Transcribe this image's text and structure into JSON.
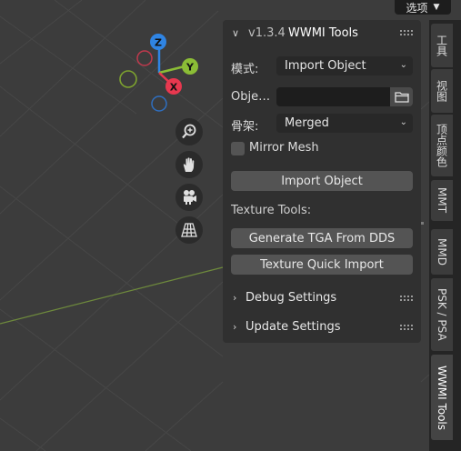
{
  "header": {
    "view_dropdown": "选项"
  },
  "gizmo": {
    "z_label": "Z",
    "y_label": "Y",
    "x_label": "X",
    "colors": {
      "x": "#e8384f",
      "y": "#8bbd36",
      "z": "#2f84e3"
    }
  },
  "navigation": {
    "buttons": [
      "zoom-icon",
      "hand-pan-icon",
      "camera-icon",
      "grid-perspective-icon"
    ]
  },
  "panel": {
    "version": "v1.3.4",
    "title": "WWMI Tools",
    "mode_label": "模式:",
    "mode_value": "Import Object",
    "object_label": "Obje…",
    "object_value": "",
    "skeleton_label": "骨架:",
    "skeleton_value": "Merged",
    "mirror_mesh_label": "Mirror Mesh",
    "mirror_mesh_checked": false,
    "import_button": "Import Object",
    "texture_tools_label": "Texture Tools:",
    "generate_tga_button": "Generate TGA From DDS",
    "texture_import_button": "Texture Quick Import",
    "debug_settings": "Debug Settings",
    "update_settings": "Update Settings"
  },
  "sidebar_tabs": [
    {
      "label": "工具",
      "active": false
    },
    {
      "label": "视图",
      "active": false
    },
    {
      "label": "顶点颜色",
      "active": false
    },
    {
      "label": "MMT",
      "active": false
    },
    {
      "label": "MMD",
      "active": false
    },
    {
      "label": "PSK / PSA",
      "active": false
    },
    {
      "label": "WWMI Tools",
      "active": true
    }
  ]
}
